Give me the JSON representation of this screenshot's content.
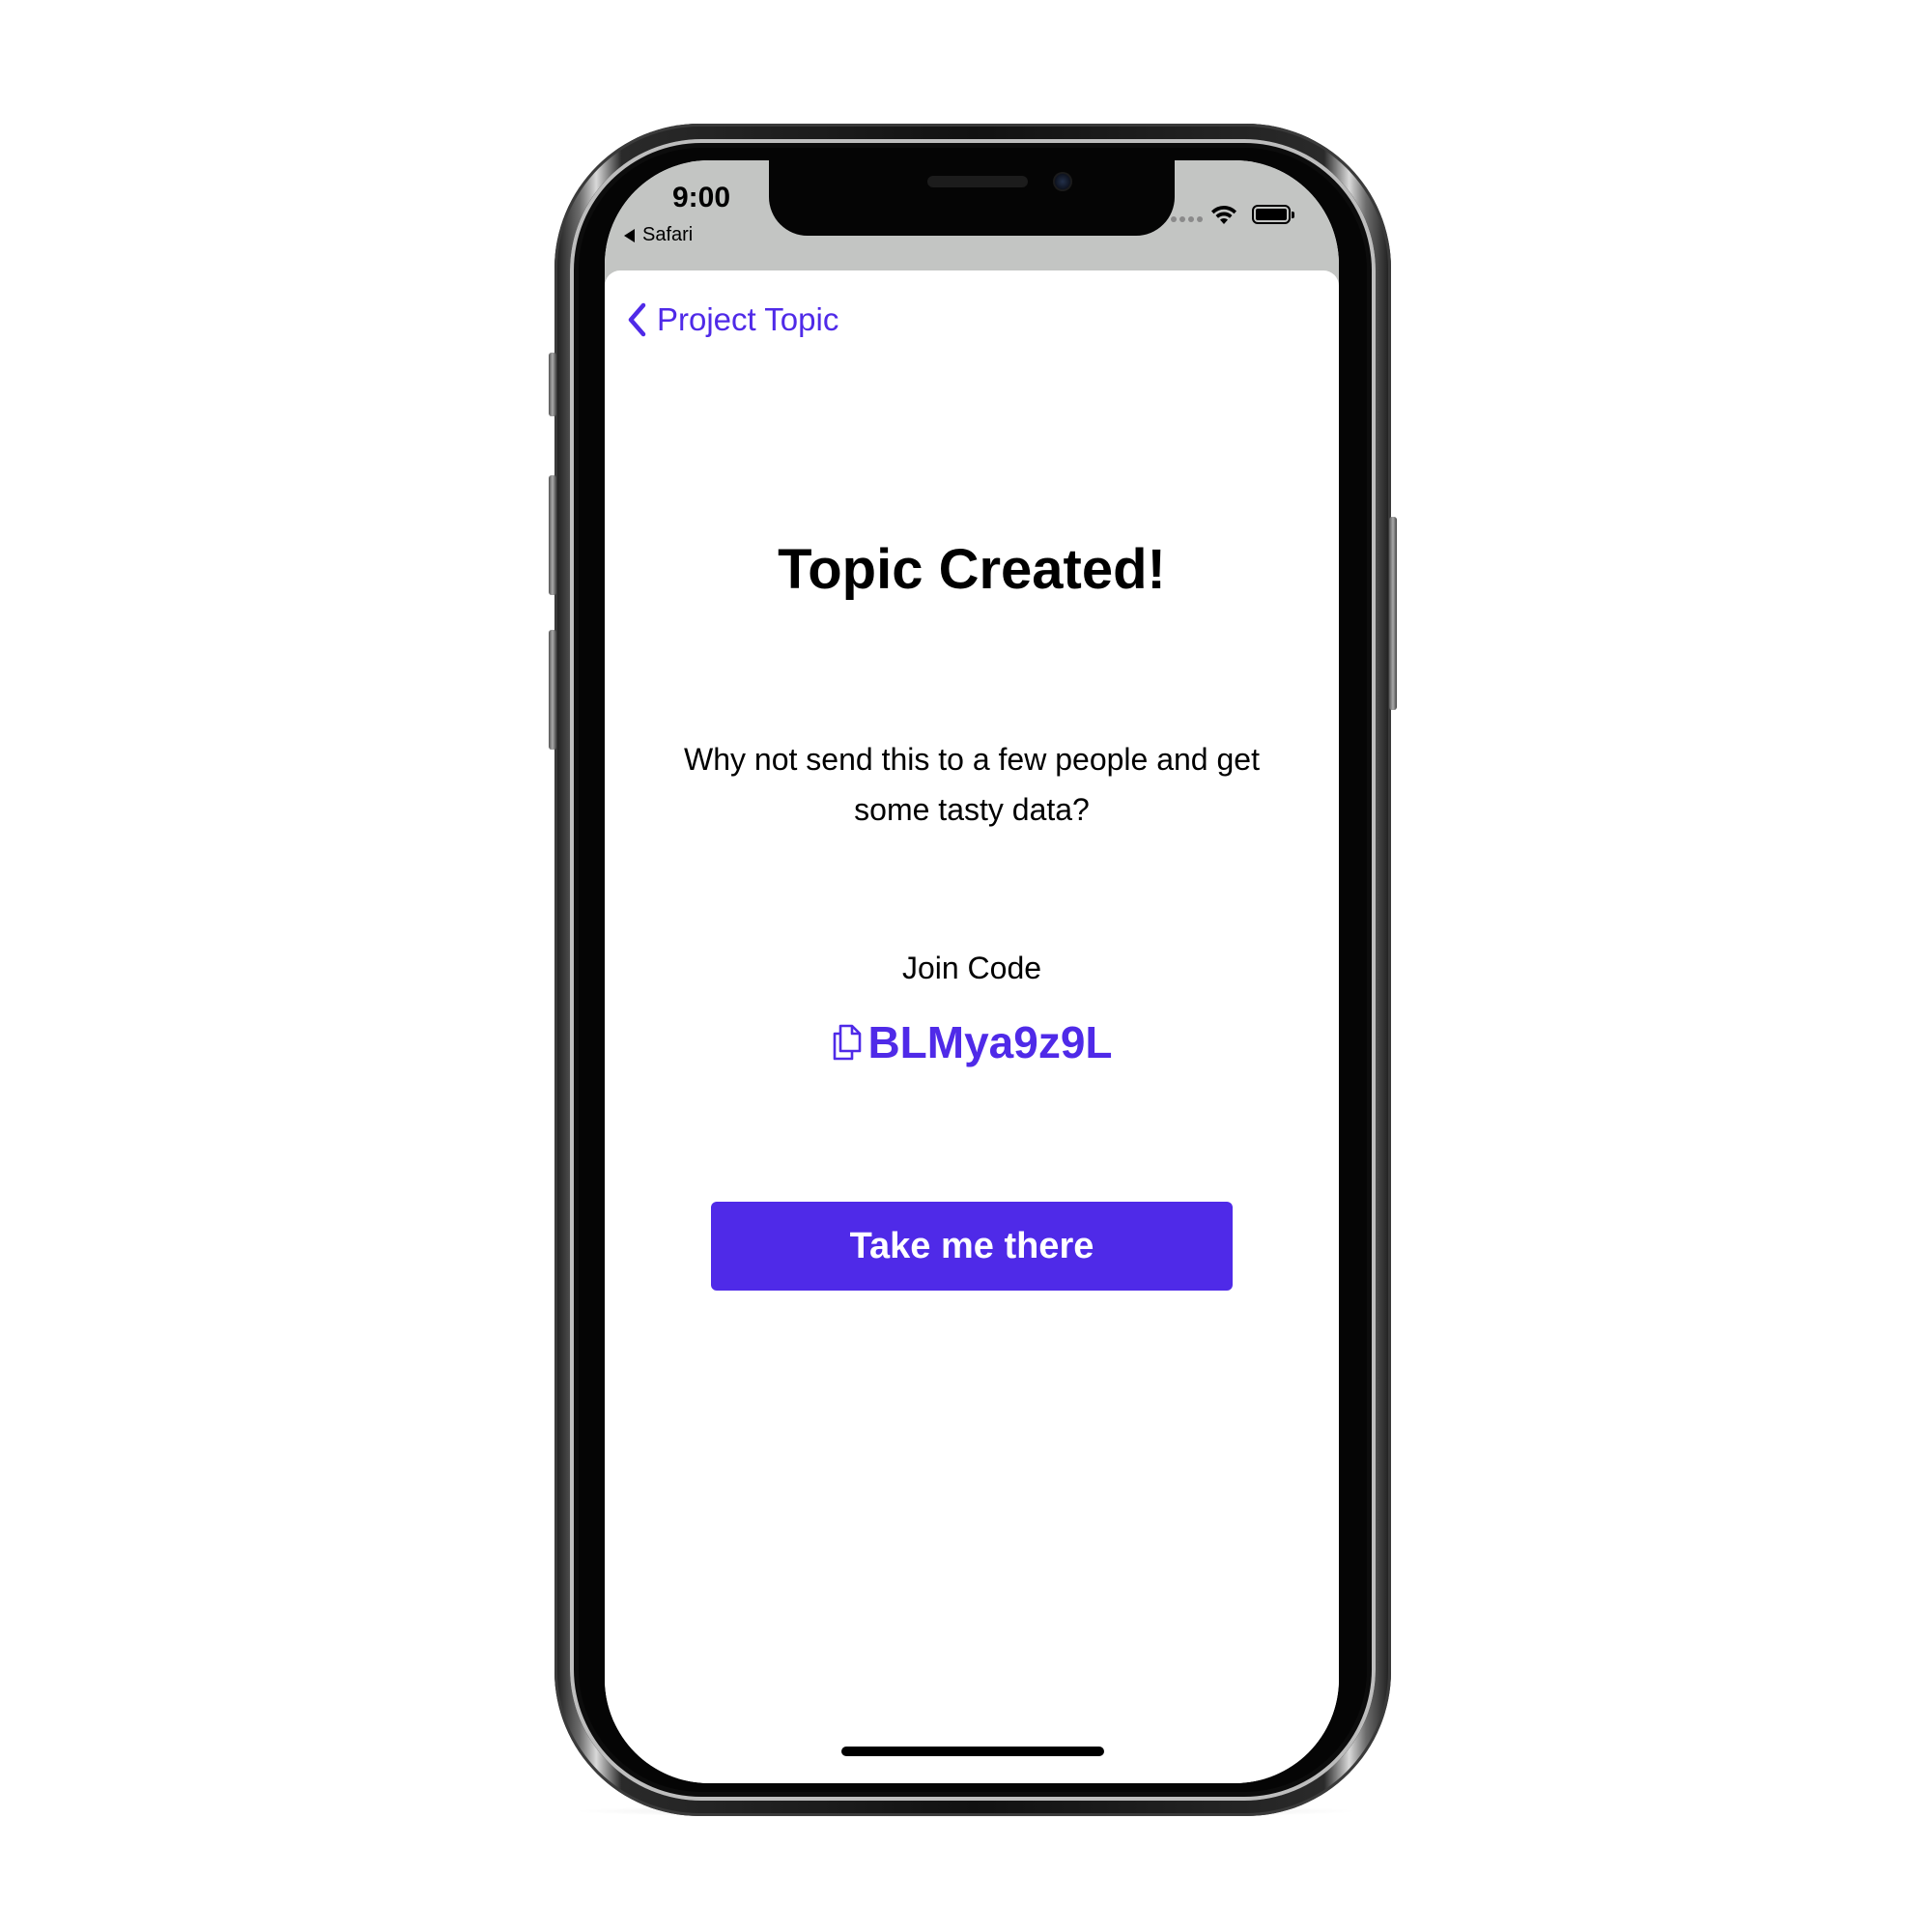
{
  "status_bar": {
    "time": "9:00",
    "back_app": "Safari"
  },
  "nav": {
    "back_label": "Project Topic"
  },
  "main": {
    "title": "Topic Created!",
    "message": "Why not send this to a few people and get some tasty data?",
    "join_label": "Join Code",
    "join_code": "BLMya9z9L",
    "cta_label": "Take me there"
  },
  "colors": {
    "accent": "#4f2ae8",
    "status_bar_bg": "#c3c5c3",
    "text": "#000000",
    "background": "#ffffff"
  },
  "icons": {
    "back": "chevron-left-icon",
    "copy": "copy-icon",
    "wifi": "wifi-icon",
    "battery": "battery-icon",
    "signal": "signal-icon"
  }
}
